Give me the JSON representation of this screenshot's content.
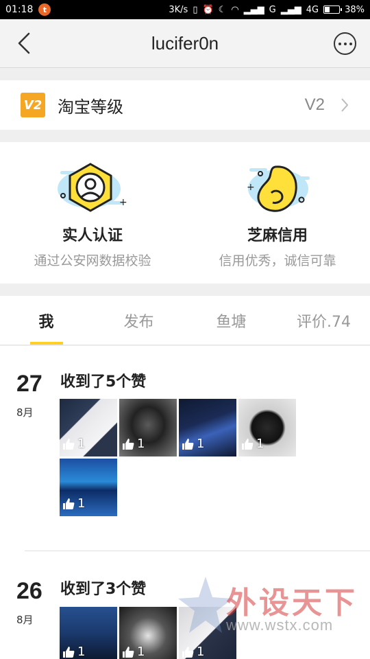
{
  "status_bar": {
    "time": "01:18",
    "app_badge": "t",
    "net_speed": "3K/s",
    "signal_label": "G",
    "network": "4G",
    "battery": "38%",
    "battery_level": 0.38
  },
  "nav": {
    "title": "lucifer0n"
  },
  "level": {
    "badge": "V2",
    "label": "淘宝等级",
    "value": "V2"
  },
  "certs": [
    {
      "title": "实人认证",
      "subtitle": "通过公安网数据校验"
    },
    {
      "title": "芝麻信用",
      "subtitle": "信用优秀，诚信可靠"
    }
  ],
  "tabs": [
    {
      "label": "我",
      "active": true
    },
    {
      "label": "发布",
      "active": false
    },
    {
      "label": "鱼塘",
      "active": false
    },
    {
      "label": "评价.74",
      "active": false
    }
  ],
  "feed": [
    {
      "day": "27",
      "month": "8月",
      "headline": "收到了5个赞",
      "photos": [
        {
          "style": "p-box1",
          "likes": "1"
        },
        {
          "style": "p-mouse",
          "likes": "1"
        },
        {
          "style": "p-box2",
          "likes": "1"
        },
        {
          "style": "p-mouse2",
          "likes": "1"
        },
        {
          "style": "p-box3",
          "likes": "1"
        }
      ]
    },
    {
      "day": "26",
      "month": "8月",
      "headline": "收到了3个赞",
      "photos": [
        {
          "style": "p-kb",
          "likes": "1"
        },
        {
          "style": "p-dark",
          "likes": "1"
        },
        {
          "style": "p-box4",
          "likes": "1"
        }
      ]
    }
  ],
  "watermark": {
    "text": "外设天下",
    "url": "www.wstx.com"
  },
  "colors": {
    "accent": "#ffcf26",
    "badge": "#f5a623",
    "watermark_red": "#d73c3c"
  }
}
